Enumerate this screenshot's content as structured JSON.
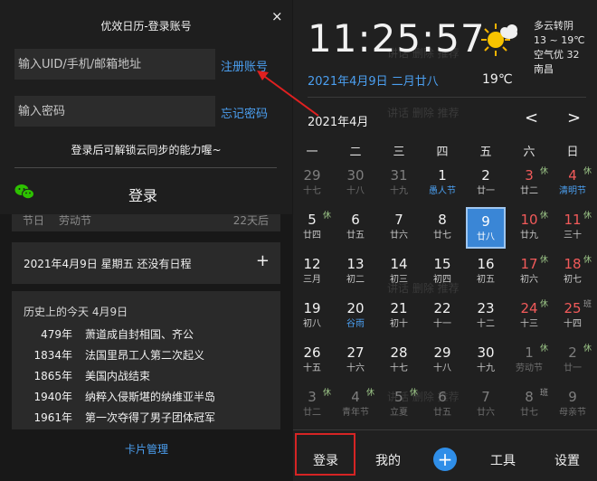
{
  "login": {
    "title": "优效日历-登录账号",
    "close": "×",
    "uid_placeholder": "输入UID/手机/邮箱地址",
    "pwd_placeholder": "输入密码",
    "register": "注册账号",
    "forgot": "忘记密码",
    "hint": "登录后可解锁云同步的能力喔~",
    "button": "登录"
  },
  "left": {
    "holiday": {
      "label": "节日",
      "name": "劳动节",
      "days": "22天后"
    },
    "schedule": {
      "text": "2021年4月9日 星期五 还没有日程",
      "add": "+"
    },
    "history": {
      "title": "历史上的今天 4月9日",
      "items": [
        {
          "year": "479年",
          "event": "萧道成自封相国、齐公"
        },
        {
          "year": "1834年",
          "event": "法国里昂工人第二次起义"
        },
        {
          "year": "1865年",
          "event": "美国内战结束"
        },
        {
          "year": "1940年",
          "event": "纳粹入侵斯堪的纳维亚半岛"
        },
        {
          "year": "1961年",
          "event": "第一次夺得了男子团体冠军"
        }
      ]
    },
    "card_manage": "卡片管理"
  },
  "calendar": {
    "time": "11:25:57",
    "date_line": "2021年4月9日  二月廿八",
    "temperature": "19℃",
    "weather": {
      "condition": "多云转阴",
      "range": "13 ~ 19℃",
      "air": "空气优 32",
      "city": "南昌",
      "icon": "sun-cloud-icon"
    },
    "month_label": "2021年4月",
    "prev": "<",
    "next": ">",
    "weekdays": [
      "一",
      "二",
      "三",
      "四",
      "五",
      "六",
      "日"
    ],
    "weeks": [
      [
        {
          "d": "29",
          "s": "十七",
          "dim": true
        },
        {
          "d": "30",
          "s": "十八",
          "dim": true
        },
        {
          "d": "31",
          "s": "十九",
          "dim": true
        },
        {
          "d": "1",
          "s": "愚人节",
          "blue": true
        },
        {
          "d": "2",
          "s": "廿一"
        },
        {
          "d": "3",
          "s": "廿二",
          "red": true,
          "tag": "休"
        },
        {
          "d": "4",
          "s": "清明节",
          "red": true,
          "blue": true,
          "tag": "休"
        }
      ],
      [
        {
          "d": "5",
          "s": "廿四",
          "tag": "休"
        },
        {
          "d": "6",
          "s": "廿五"
        },
        {
          "d": "7",
          "s": "廿六"
        },
        {
          "d": "8",
          "s": "廿七"
        },
        {
          "d": "9",
          "s": "廿八",
          "today": true
        },
        {
          "d": "10",
          "s": "廿九",
          "red": true,
          "tag": "休"
        },
        {
          "d": "11",
          "s": "三十",
          "red": true,
          "tag": "休"
        }
      ],
      [
        {
          "d": "12",
          "s": "三月"
        },
        {
          "d": "13",
          "s": "初二"
        },
        {
          "d": "14",
          "s": "初三"
        },
        {
          "d": "15",
          "s": "初四"
        },
        {
          "d": "16",
          "s": "初五"
        },
        {
          "d": "17",
          "s": "初六",
          "red": true,
          "tag": "休"
        },
        {
          "d": "18",
          "s": "初七",
          "red": true,
          "tag": "休"
        }
      ],
      [
        {
          "d": "19",
          "s": "初八"
        },
        {
          "d": "20",
          "s": "谷雨",
          "blue": true
        },
        {
          "d": "21",
          "s": "初十"
        },
        {
          "d": "22",
          "s": "十一"
        },
        {
          "d": "23",
          "s": "十二"
        },
        {
          "d": "24",
          "s": "十三",
          "red": true,
          "tag": "休"
        },
        {
          "d": "25",
          "s": "十四",
          "red": true,
          "tag": "班",
          "ban": true
        }
      ],
      [
        {
          "d": "26",
          "s": "十五"
        },
        {
          "d": "27",
          "s": "十六"
        },
        {
          "d": "28",
          "s": "十七"
        },
        {
          "d": "29",
          "s": "十八"
        },
        {
          "d": "30",
          "s": "十九"
        },
        {
          "d": "1",
          "s": "劳动节",
          "dim": true,
          "tag": "休"
        },
        {
          "d": "2",
          "s": "廿一",
          "dim": true,
          "tag": "休"
        }
      ],
      [
        {
          "d": "3",
          "s": "廿二",
          "dim": true,
          "tag": "休"
        },
        {
          "d": "4",
          "s": "青年节",
          "dim": true,
          "tag": "休"
        },
        {
          "d": "5",
          "s": "立夏",
          "dim": true,
          "tag": "休"
        },
        {
          "d": "6",
          "s": "廿五",
          "dim": true
        },
        {
          "d": "7",
          "s": "廿六",
          "dim": true
        },
        {
          "d": "8",
          "s": "廿七",
          "dim": true,
          "tag": "班",
          "ban": true
        },
        {
          "d": "9",
          "s": "母亲节",
          "dim": true
        }
      ]
    ],
    "tabs": {
      "login": "登录",
      "mine": "我的",
      "add": "+",
      "tools": "工具",
      "settings": "设置"
    }
  },
  "colors": {
    "accent_blue": "#4b9ff0",
    "holiday_red": "#f25a5a",
    "rest_green": "#9fc98a",
    "highlight_red": "#d62424",
    "today_bg": "#3a86d6"
  }
}
